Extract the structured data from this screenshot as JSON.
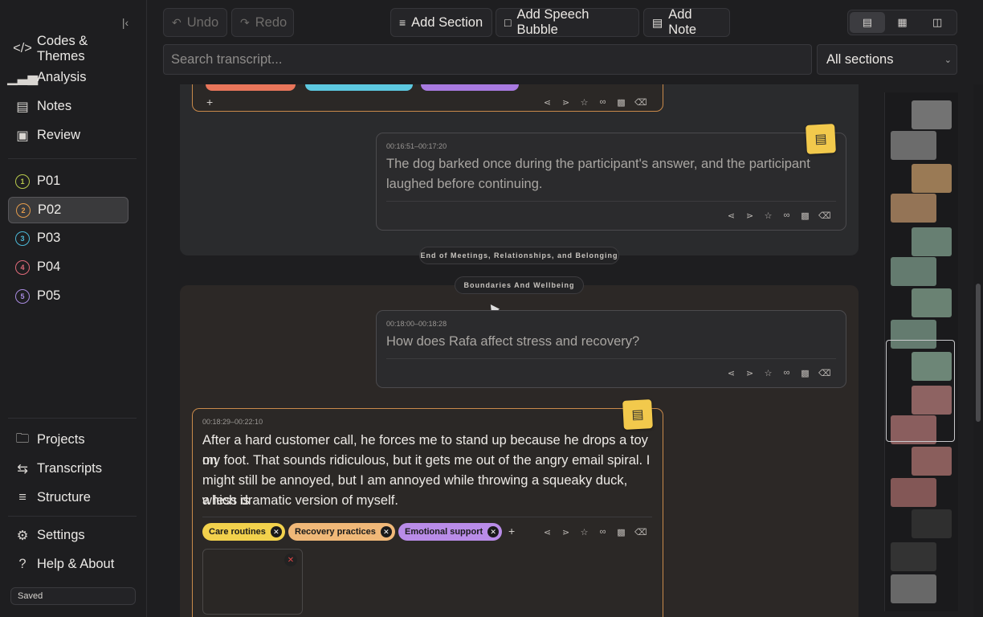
{
  "sidebar": {
    "collapse_icon": "collapse-left-icon",
    "nav": [
      {
        "label": "Codes & Themes",
        "icon": "code-icon"
      },
      {
        "label": "Analysis",
        "icon": "bar-chart-icon"
      },
      {
        "label": "Notes",
        "icon": "note-icon"
      },
      {
        "label": "Review",
        "icon": "review-icon"
      }
    ],
    "participants": [
      {
        "num": "1",
        "label": "P01",
        "color": "#b8c94c"
      },
      {
        "num": "2",
        "label": "P02",
        "color": "#e39b4c"
      },
      {
        "num": "3",
        "label": "P03",
        "color": "#4cb8d6"
      },
      {
        "num": "4",
        "label": "P04",
        "color": "#e06a7a"
      },
      {
        "num": "5",
        "label": "P05",
        "color": "#a88be0"
      }
    ],
    "bottom_nav": [
      {
        "label": "Projects",
        "icon": "folder-icon"
      },
      {
        "label": "Transcripts",
        "icon": "transcripts-icon"
      },
      {
        "label": "Structure",
        "icon": "structure-icon"
      }
    ],
    "settings": [
      {
        "label": "Settings",
        "icon": "gear-icon"
      },
      {
        "label": "Help & About",
        "icon": "help-icon"
      }
    ],
    "status": "Saved"
  },
  "toolbar": {
    "undo": "Undo",
    "redo": "Redo",
    "add_section": "Add Section",
    "add_speech_bubble": "Add Speech Bubble",
    "add_note": "Add Note",
    "search_placeholder": "Search transcript...",
    "section_filter": "All sections"
  },
  "transcript": {
    "section_end_label": "End of Meetings, Relationships, and Belonging",
    "section_start_label": "Boundaries And Wellbeing",
    "cards": [
      {
        "timestamp": "00:16:51–00:17:20",
        "text_line1": "The dog barked once during the participant's answer, and the participant",
        "text_line2": "laughed before continuing."
      },
      {
        "timestamp": "00:18:00–00:18:28",
        "text_line1": "How does Rafa affect stress and recovery?"
      },
      {
        "timestamp": "00:18:29–00:22:10",
        "text_line1": "After a hard customer call, he forces me to stand up because he drops a toy on",
        "text_line2": "my foot. That sounds ridiculous, but it gets me out of the angry email spiral. I",
        "text_line3": "might still be annoyed, but I am annoyed while throwing a squeaky duck, which is",
        "text_line4": "a less dramatic version of myself.",
        "tags": [
          {
            "label": "Care routines",
            "color": "#f2d14c"
          },
          {
            "label": "Recovery practices",
            "color": "#f0b878"
          },
          {
            "label": "Emotional support",
            "color": "#b98ce8"
          }
        ]
      }
    ]
  },
  "colors": {
    "accent_highlight": "#c98a4b",
    "note_yellow": "#f2c94c"
  }
}
